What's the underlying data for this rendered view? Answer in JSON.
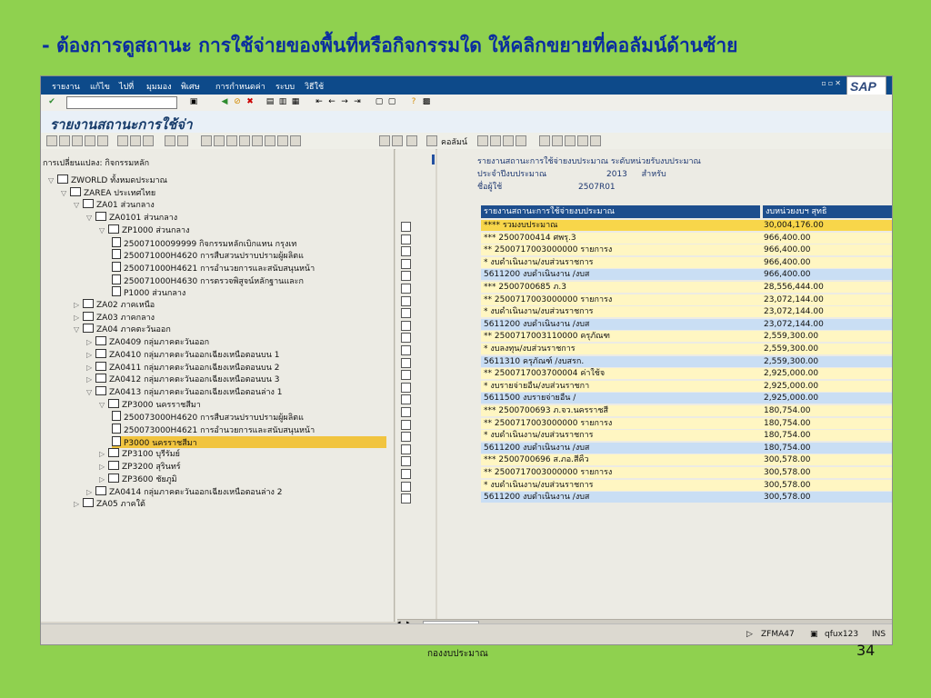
{
  "slide": {
    "title": "- ต้องการดูสถานะ การใช้จ่ายของพื้นที่หรือกิจกรรมใด ให้คลิกขยายที่คอลัมน์ด้านซ้าย",
    "footer": "กองงบประมาณ",
    "page_number": "34"
  },
  "sap": {
    "menu": [
      "รายงาน",
      "แก้ไข",
      "ไปที่",
      "มุมมอง",
      "พิเศษ",
      "การกำหนดค่า",
      "ระบบ",
      "วิธีใช้"
    ],
    "logo": "SAP",
    "window_title": "รายงานสถานะการใช้จ่า",
    "columns_label": "คอลัมน์"
  },
  "left_tree": {
    "header": "การเปลี่ยนแปลง: กิจกรรมหลัก",
    "rows": [
      {
        "level": 0,
        "type": "folder",
        "open": true,
        "label": "ZWORLD ทั้งหมดประมาณ"
      },
      {
        "level": 1,
        "type": "folder",
        "open": true,
        "label": "ZAREA ประเทศไทย"
      },
      {
        "level": 2,
        "type": "folder",
        "open": true,
        "label": "ZA01 ส่วนกลาง"
      },
      {
        "level": 3,
        "type": "folder",
        "open": true,
        "label": "ZA0101 ส่วนกลาง"
      },
      {
        "level": 4,
        "type": "folder",
        "open": true,
        "label": "ZP1000 ส่วนกลาง"
      },
      {
        "level": 5,
        "type": "doc",
        "label": "25007100099999 กิจกรรมหลักเบิกแทน กรุงเท"
      },
      {
        "level": 5,
        "type": "doc",
        "label": "250071000H4620 การสืบสวนปราบปรามผู้ผลิตแ"
      },
      {
        "level": 5,
        "type": "doc",
        "label": "250071000H4621 การอำนวยการและสนับสนุนหน้า"
      },
      {
        "level": 5,
        "type": "doc",
        "label": "250071000H4630 การตรวจพิสูจน์หลักฐานและก"
      },
      {
        "level": 5,
        "type": "doc",
        "label": "P1000 ส่วนกลาง"
      },
      {
        "level": 2,
        "type": "folder",
        "open": false,
        "label": "ZA02 ภาคเหนือ"
      },
      {
        "level": 2,
        "type": "folder",
        "open": false,
        "label": "ZA03 ภาคกลาง"
      },
      {
        "level": 2,
        "type": "folder",
        "open": true,
        "label": "ZA04 ภาคตะวันออก"
      },
      {
        "level": 3,
        "type": "folder",
        "open": false,
        "label": "ZA0409 กลุ่มภาคตะวันออก"
      },
      {
        "level": 3,
        "type": "folder",
        "open": false,
        "label": "ZA0410 กลุ่มภาคตะวันออกเฉียงเหนือตอนบน 1"
      },
      {
        "level": 3,
        "type": "folder",
        "open": false,
        "label": "ZA0411 กลุ่มภาคตะวันออกเฉียงเหนือตอนบน 2"
      },
      {
        "level": 3,
        "type": "folder",
        "open": false,
        "label": "ZA0412 กลุ่มภาคตะวันออกเฉียงเหนือตอนบน 3"
      },
      {
        "level": 3,
        "type": "folder",
        "open": true,
        "label": "ZA0413 กลุ่มภาคตะวันออกเฉียงเหนือตอนล่าง 1"
      },
      {
        "level": 4,
        "type": "folder",
        "open": true,
        "label": "ZP3000 นครราชสีมา"
      },
      {
        "level": 5,
        "type": "doc",
        "label": "250073000H4620 การสืบสวนปราบปรามผู้ผลิตแ"
      },
      {
        "level": 5,
        "type": "doc",
        "label": "250073000H4621 การอำนวยการและสนับสนุนหน้า"
      },
      {
        "level": 5,
        "type": "doc",
        "label": "P3000 นครราชสีมา",
        "selected": true
      },
      {
        "level": 4,
        "type": "folder",
        "open": false,
        "label": "ZP3100 บุรีรัมย์"
      },
      {
        "level": 4,
        "type": "folder",
        "open": false,
        "label": "ZP3200 สุรินทร์"
      },
      {
        "level": 4,
        "type": "folder",
        "open": false,
        "label": "ZP3600 ชัยภูมิ"
      },
      {
        "level": 3,
        "type": "folder",
        "open": false,
        "label": "ZA0414 กลุ่มภาคตะวันออกเฉียงเหนือตอนล่าง 2"
      },
      {
        "level": 2,
        "type": "folder",
        "open": false,
        "label": "ZA05 ภาคใต้"
      }
    ]
  },
  "report": {
    "line1": "รายงานสถานะการใช้จ่ายงบประมาณ ระดับหน่วยรับงบประมาณ",
    "line2_label": "ประจำปีงบประมาณ",
    "line2_year": "2013",
    "line2_suffix": "สำหรับ",
    "line3_label": "ชื่อผู้ใช้",
    "line3_value": "2507R01",
    "headers": [
      "รายงานสถานะการใช้จ่ายงบประมาณ",
      "งบหน่วยงบฯ สุทธิ",
      "กิ"
    ],
    "rows": [
      {
        "label": "**** รวมงบประมาณ",
        "value": "30,004,176.00",
        "style": "yellow"
      },
      {
        "label": "*** 2500700414 ศพรุ.3",
        "value": "966,400.00",
        "style": "lightyellow"
      },
      {
        "label": "** 2500717003000000 รายการง",
        "value": "966,400.00",
        "style": "lightyellow"
      },
      {
        "label": "* งบดำเนินงาน/งบส่วนราชการ",
        "value": "966,400.00",
        "style": "lightyellow"
      },
      {
        "label": "5611200 งบดำเนินงาน /งบส",
        "value": "966,400.00",
        "style": "blue"
      },
      {
        "label": "*** 2500700685 ภ.3",
        "value": "28,556,444.00",
        "style": "lightyellow"
      },
      {
        "label": "** 2500717003000000 รายการง",
        "value": "23,072,144.00",
        "style": "lightyellow"
      },
      {
        "label": "* งบดำเนินงาน/งบส่วนราชการ",
        "value": "23,072,144.00",
        "style": "lightyellow"
      },
      {
        "label": "5611200 งบดำเนินงาน /งบส",
        "value": "23,072,144.00",
        "style": "blue"
      },
      {
        "label": "** 2500717003110000 ครุภัณฑ",
        "value": "2,559,300.00",
        "style": "lightyellow"
      },
      {
        "label": "* งบลงทุน/งบส่วนราชการ",
        "value": "2,559,300.00",
        "style": "lightyellow"
      },
      {
        "label": "5611310 ครุภัณฑ์ /งบสรก.",
        "value": "2,559,300.00",
        "style": "blue"
      },
      {
        "label": "** 2500717003700004 ค่าใช้จ",
        "value": "2,925,000.00",
        "style": "lightyellow"
      },
      {
        "label": "* งบรายจ่ายอื่น/งบส่วนราชกา",
        "value": "2,925,000.00",
        "style": "lightyellow"
      },
      {
        "label": "5611500 งบรายจ่ายอื่น /",
        "value": "2,925,000.00",
        "style": "blue"
      },
      {
        "label": "*** 2500700693 ภ.จว.นครราชสี",
        "value": "180,754.00",
        "style": "lightyellow"
      },
      {
        "label": "** 2500717003000000 รายการง",
        "value": "180,754.00",
        "style": "lightyellow"
      },
      {
        "label": "* งบดำเนินงาน/งบส่วนราชการ",
        "value": "180,754.00",
        "style": "lightyellow"
      },
      {
        "label": "5611200 งบดำเนินงาน /งบส",
        "value": "180,754.00",
        "style": "blue"
      },
      {
        "label": "*** 2500700696 ส.ภอ.สีคิ้ว",
        "value": "300,578.00",
        "style": "lightyellow"
      },
      {
        "label": "** 2500717003000000 รายการง",
        "value": "300,578.00",
        "style": "lightyellow"
      },
      {
        "label": "* งบดำเนินงาน/งบส่วนราชการ",
        "value": "300,578.00",
        "style": "lightyellow"
      },
      {
        "label": "5611200 งบดำเนินงาน /งบส",
        "value": "300,578.00",
        "style": "blue"
      }
    ]
  },
  "status": {
    "tcode": "ZFMA47",
    "server": "qfux123",
    "mode": "INS"
  },
  "colors": {
    "background": "#8fd14f",
    "title": "#0b2d9f",
    "yellow": "#f8d64a",
    "lightyellow": "#fff6c2",
    "blue": "#c9def4"
  }
}
